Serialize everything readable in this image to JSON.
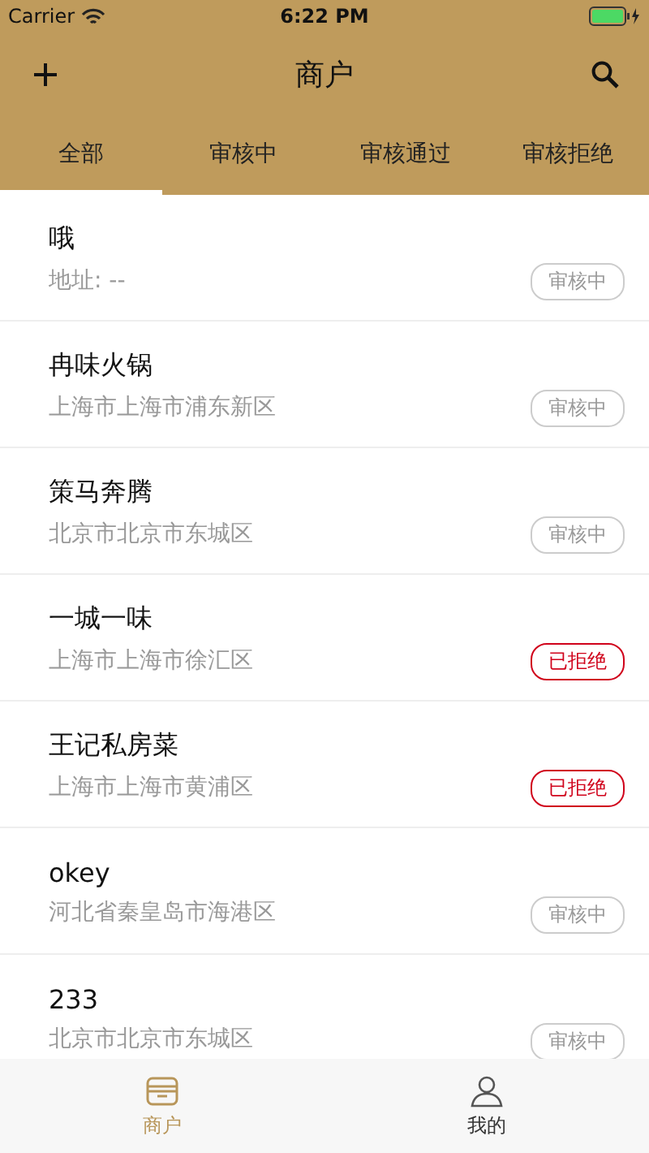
{
  "status_bar": {
    "carrier": "Carrier",
    "time": "6:22 PM"
  },
  "nav": {
    "title": "商户"
  },
  "tabs": [
    {
      "label": "全部",
      "selected": true
    },
    {
      "label": "审核中",
      "selected": false
    },
    {
      "label": "审核通过",
      "selected": false
    },
    {
      "label": "审核拒绝",
      "selected": false
    }
  ],
  "merchants": [
    {
      "name": "哦",
      "address": "地址: --",
      "status": "审核中",
      "kind": "pending"
    },
    {
      "name": "冉味火锅",
      "address": "上海市上海市浦东新区",
      "status": "审核中",
      "kind": "pending"
    },
    {
      "name": "策马奔腾",
      "address": "北京市北京市东城区",
      "status": "审核中",
      "kind": "pending"
    },
    {
      "name": "一城一味",
      "address": "上海市上海市徐汇区",
      "status": "已拒绝",
      "kind": "rejected"
    },
    {
      "name": "王记私房菜",
      "address": "上海市上海市黄浦区",
      "status": "已拒绝",
      "kind": "rejected"
    },
    {
      "name": "okey",
      "address": "河北省秦皇岛市海港区",
      "status": "审核中",
      "kind": "pending"
    },
    {
      "name": "233",
      "address": "北京市北京市东城区",
      "status": "审核中",
      "kind": "pending"
    }
  ],
  "tab_bar": [
    {
      "label": "商户",
      "selected": true,
      "kind": "shop"
    },
    {
      "label": "我的",
      "selected": false,
      "kind": "user"
    }
  ]
}
